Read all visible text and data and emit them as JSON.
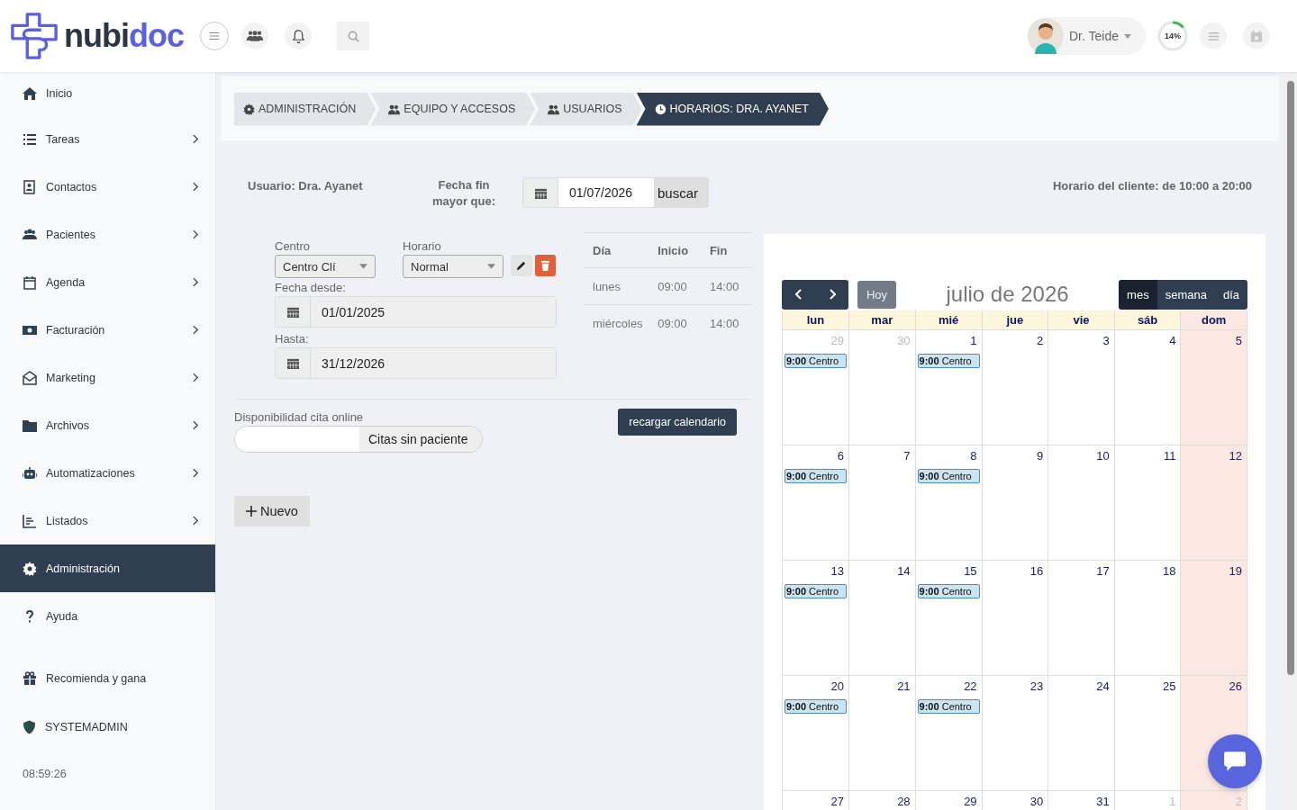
{
  "header": {
    "logo": [
      "nubi",
      "doc"
    ],
    "user": {
      "name": "Dr. Teide"
    },
    "progress": {
      "label": "14%",
      "level": 0.14
    }
  },
  "sidebar": {
    "items": [
      {
        "label": "Inicio",
        "has_submenu": false,
        "selected": false
      },
      {
        "label": "Tareas",
        "has_submenu": true,
        "selected": false
      },
      {
        "label": "Contactos",
        "has_submenu": true,
        "selected": false
      },
      {
        "label": "Pacientes",
        "has_submenu": true,
        "selected": false
      },
      {
        "label": "Agenda",
        "has_submenu": true,
        "selected": false
      },
      {
        "label": "Facturación",
        "has_submenu": true,
        "selected": false
      },
      {
        "label": "Marketing",
        "has_submenu": true,
        "selected": false
      },
      {
        "label": "Archivos",
        "has_submenu": true,
        "selected": false
      },
      {
        "label": "Automatizaciones",
        "has_submenu": true,
        "selected": false
      },
      {
        "label": "Listados",
        "has_submenu": true,
        "selected": false
      },
      {
        "label": "Administración",
        "has_submenu": false,
        "selected": true
      },
      {
        "label": "Ayuda",
        "has_submenu": false,
        "selected": false
      }
    ],
    "footer": [
      "Recomienda y gana",
      "SYSTEMADMIN"
    ],
    "clock": "08:59:26"
  },
  "breadcrumbs": [
    {
      "label": "ADMINISTRACIÓN",
      "selected": false
    },
    {
      "label": "EQUIPO Y ACCESOS",
      "selected": false
    },
    {
      "label": "USUARIOS",
      "selected": false
    },
    {
      "label": "HORARIOS: DRA. AYANET",
      "selected": true
    }
  ],
  "user_label": "Usuario: Dra. Ayanet",
  "date_filter": {
    "label": "Fecha fin mayor que:",
    "value": "01/07/2026",
    "button": "buscar"
  },
  "client_hours": "Horario del cliente: de 10:00 a 20:00",
  "schedule_form": {
    "centro": {
      "label": "Centro",
      "value": "Centro Clí"
    },
    "horario": {
      "label": "Horario",
      "value": "Normal"
    },
    "from": {
      "label": "Fecha desde:",
      "value": "01/01/2025"
    },
    "to": {
      "label": "Hasta:",
      "value": "31/12/2026"
    }
  },
  "schedule_table": {
    "columns": [
      "Día",
      "Inicio",
      "Fin"
    ],
    "rows": [
      [
        "lunes",
        "09:00",
        "14:00"
      ],
      [
        "miércoles",
        "09:00",
        "14:00"
      ]
    ]
  },
  "online": {
    "label": "Disponibilidad cita online",
    "value": "Citas sin paciente"
  },
  "reload_button": "recargar calendario",
  "new_button": "Nuevo",
  "calendar": {
    "today_button": "Hoy",
    "title": "julio de 2026",
    "views": [
      {
        "label": "mes",
        "selected": true
      },
      {
        "label": "semana",
        "selected": false
      },
      {
        "label": "día",
        "selected": false
      }
    ],
    "weekdays": [
      {
        "label": "lun",
        "weekend": false
      },
      {
        "label": "mar",
        "weekend": false
      },
      {
        "label": "mié",
        "weekend": false
      },
      {
        "label": "jue",
        "weekend": false
      },
      {
        "label": "vie",
        "weekend": false
      },
      {
        "label": "sáb",
        "weekend": false
      },
      {
        "label": "dom",
        "weekend": true
      }
    ],
    "weeks": [
      [
        {
          "day": "29",
          "other_month": true,
          "events": [
            {
              "time": "9:00",
              "title": "Centro"
            }
          ]
        },
        {
          "day": "30",
          "other_month": true
        },
        {
          "day": "1",
          "other_month": false,
          "events": [
            {
              "time": "9:00",
              "title": "Centro"
            }
          ]
        },
        {
          "day": "2",
          "other_month": false
        },
        {
          "day": "3",
          "other_month": false
        },
        {
          "day": "4",
          "other_month": false
        },
        {
          "day": "5",
          "other_month": false
        }
      ],
      [
        {
          "day": "6",
          "other_month": false,
          "events": [
            {
              "time": "9:00",
              "title": "Centro"
            }
          ]
        },
        {
          "day": "7",
          "other_month": false
        },
        {
          "day": "8",
          "other_month": false,
          "events": [
            {
              "time": "9:00",
              "title": "Centro"
            }
          ]
        },
        {
          "day": "9",
          "other_month": false
        },
        {
          "day": "10",
          "other_month": false
        },
        {
          "day": "11",
          "other_month": false
        },
        {
          "day": "12",
          "other_month": false
        }
      ],
      [
        {
          "day": "13",
          "other_month": false,
          "events": [
            {
              "time": "9:00",
              "title": "Centro"
            }
          ]
        },
        {
          "day": "14",
          "other_month": false
        },
        {
          "day": "15",
          "other_month": false,
          "events": [
            {
              "time": "9:00",
              "title": "Centro"
            }
          ]
        },
        {
          "day": "16",
          "other_month": false
        },
        {
          "day": "17",
          "other_month": false
        },
        {
          "day": "18",
          "other_month": false
        },
        {
          "day": "19",
          "other_month": false
        }
      ],
      [
        {
          "day": "20",
          "other_month": false,
          "events": [
            {
              "time": "9:00",
              "title": "Centro"
            }
          ]
        },
        {
          "day": "21",
          "other_month": false
        },
        {
          "day": "22",
          "other_month": false,
          "events": [
            {
              "time": "9:00",
              "title": "Centro"
            }
          ]
        },
        {
          "day": "23",
          "other_month": false
        },
        {
          "day": "24",
          "other_month": false
        },
        {
          "day": "25",
          "other_month": false
        },
        {
          "day": "26",
          "other_month": false
        }
      ],
      [
        {
          "day": "27",
          "other_month": false
        },
        {
          "day": "28",
          "other_month": false
        },
        {
          "day": "29",
          "other_month": false
        },
        {
          "day": "30",
          "other_month": false
        },
        {
          "day": "31",
          "other_month": false
        },
        {
          "day": "1",
          "other_month": true
        },
        {
          "day": "2",
          "other_month": true
        }
      ]
    ]
  }
}
